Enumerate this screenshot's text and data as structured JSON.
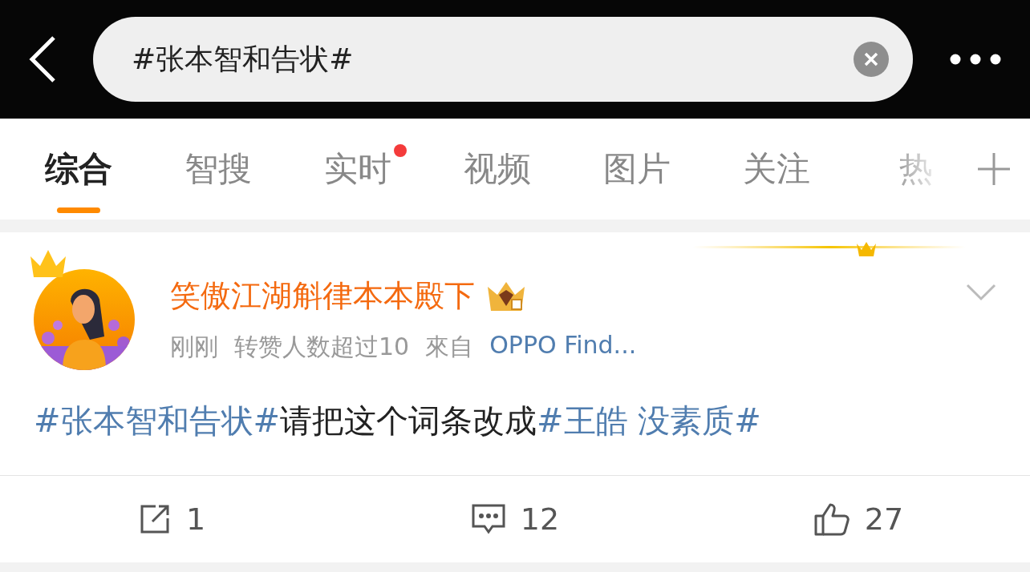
{
  "search": {
    "value": "#张本智和告状#"
  },
  "tabs": [
    {
      "label": "综合",
      "selected": true,
      "dot": false,
      "faded": false
    },
    {
      "label": "智搜",
      "selected": false,
      "dot": false,
      "faded": false
    },
    {
      "label": "实时",
      "selected": false,
      "dot": true,
      "faded": false
    },
    {
      "label": "视频",
      "selected": false,
      "dot": false,
      "faded": false
    },
    {
      "label": "图片",
      "selected": false,
      "dot": false,
      "faded": false
    },
    {
      "label": "关注",
      "selected": false,
      "dot": false,
      "faded": false
    },
    {
      "label": "热",
      "selected": false,
      "dot": false,
      "faded": true
    }
  ],
  "post": {
    "author": "笑傲江湖斛律本本殿下",
    "meta": [
      {
        "kind": "text",
        "text": "刚刚"
      },
      {
        "kind": "text",
        "text": "转赞人数超过10"
      },
      {
        "kind": "text",
        "text": "來自"
      },
      {
        "kind": "link",
        "text": "OPPO Find..."
      }
    ],
    "content": [
      {
        "kind": "tag",
        "text": "#张本智和告状#"
      },
      {
        "kind": "text",
        "text": "请把这个词条改成"
      },
      {
        "kind": "tag",
        "text": "#王皓 没素质#"
      }
    ],
    "actions": [
      {
        "kind": "share",
        "count": "1"
      },
      {
        "kind": "comment",
        "count": "12"
      },
      {
        "kind": "like",
        "count": "27"
      }
    ]
  }
}
